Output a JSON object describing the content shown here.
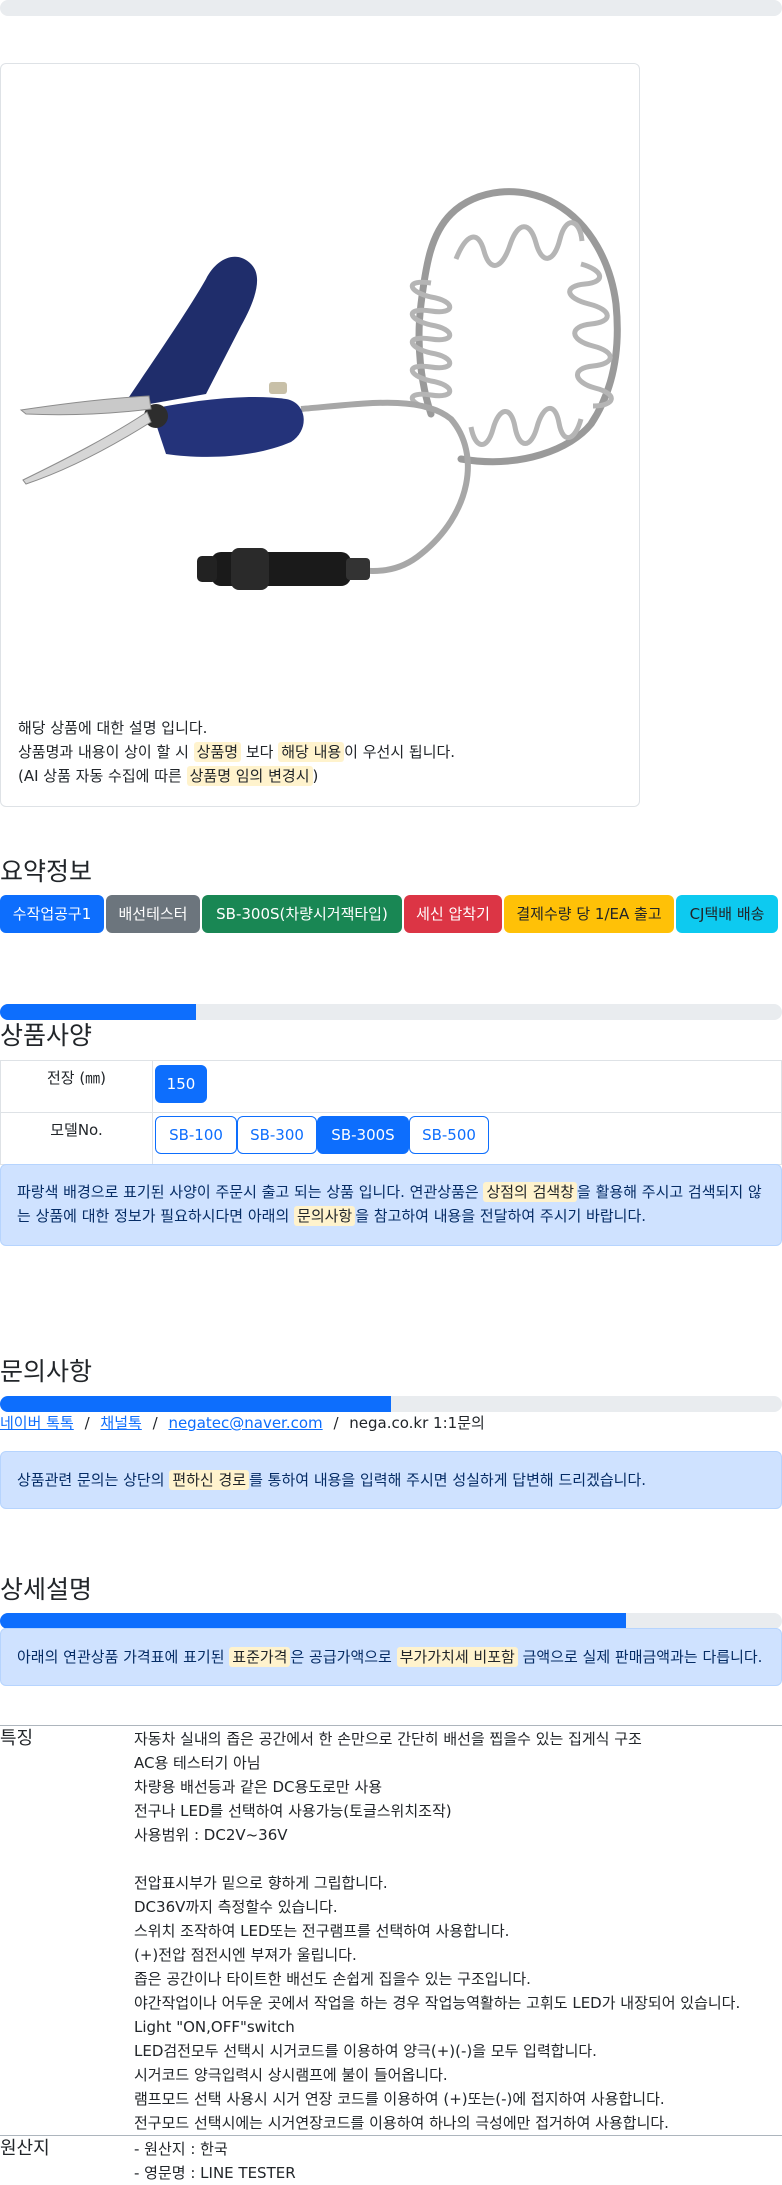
{
  "product_card": {
    "image_alt": "SB-300S 배선테스터",
    "desc_line1": "해당 상품에 대한 설명 입니다.",
    "desc_line2_pre": "상품명과 내용이 상이 할 시 ",
    "desc_line2_mark1": "상품명",
    "desc_line2_mid": " 보다 ",
    "desc_line2_mark2": "해당 내용",
    "desc_line2_post": "이 우선시 됩니다.",
    "desc_line3_pre": "(AI 상품 자동 수집에 따른 ",
    "desc_line3_mark": "상품명 임의 변경시",
    "desc_line3_post": ")"
  },
  "summary": {
    "title": "요약정보",
    "badges": [
      {
        "label": "수작업공구1",
        "color": "#0d6efd"
      },
      {
        "label": "배선테스터",
        "color": "#6c757d"
      },
      {
        "label": "SB-300S(차량시거잭타입)",
        "color": "#198754"
      },
      {
        "label": "세신 압착기",
        "color": "#dc3545"
      },
      {
        "label": "결제수량 당 1/EA 출고",
        "color": "#ffc107"
      },
      {
        "label": "CJ택배 배송",
        "color": "#0dcaf0"
      }
    ]
  },
  "spec": {
    "title": "상품사양",
    "progress": 0.25,
    "rows": [
      {
        "label": "전장 (㎜)",
        "options": [
          "150"
        ],
        "selected": "150"
      },
      {
        "label": "모델No.",
        "options": [
          "SB-100",
          "SB-300",
          "SB-300S",
          "SB-500"
        ],
        "selected": "SB-300S"
      }
    ],
    "notice_pre": "파랑색 배경으로 표기된 사양이 주문시 출고 되는 상품 입니다. 연관상품은 ",
    "notice_mark1": "상점의 검색창",
    "notice_mid": "을 활용해 주시고 검색되지 않는 상품에 대한 정보가 필요하시다면 아래의 ",
    "notice_mark2": "문의사항",
    "notice_post": "을 참고하여 내용을 전달하여 주시기 바랍니다."
  },
  "inquiry": {
    "title": "문의사항",
    "progress": 0.5,
    "links": [
      "네이버 톡톡",
      "채널톡",
      "negatec@naver.com"
    ],
    "separator": "/",
    "plain": "nega.co.kr 1:1문의",
    "notice_pre": "상품관련 문의는 상단의 ",
    "notice_mark": "편하신 경로",
    "notice_post": "를 통하여 내용을 입력해 주시면 성실하게 답변해 드리겠습니다."
  },
  "detail": {
    "title": "상세설명",
    "progress": 0.8,
    "notice_pre": "아래의 연관상품 가격표에 표기된 ",
    "notice_mark1": "표준가격",
    "notice_mid": "은 공급가액으로 ",
    "notice_mark2": "부가가치세 비포함",
    "notice_post": " 금액으로 실제 판매금액과는 다릅니다.",
    "features_label": "특징",
    "features": [
      "자동차 실내의 좁은 공간에서 한 손만으로 간단히 배선을 찝을수 있는 집게식 구조",
      "AC용 테스터기 아님",
      "차량용 배선등과 같은 DC용도로만 사용",
      "전구나 LED를 선택하여 사용가능(토글스위치조작)",
      "사용범위 : DC2V~36V",
      "",
      "전압표시부가 밑으로 향하게 그립합니다.",
      "DC36V까지 측정할수 있습니다.",
      "스위치 조작하여 LED또는 전구램프를 선택하여 사용합니다.",
      "(+)전압 점전시엔 부져가 울립니다.",
      "좁은 공간이나 타이트한 배선도 손쉽게 집을수 있는 구조입니다.",
      "야간작업이나 어두운 곳에서 작업을 하는 경우 작업능역활하는 고휘도 LED가 내장되어 있습니다.",
      "Light \"ON,OFF\"switch",
      "LED검전모두 선택시 시거코드를 이용하여 양극(+)(-)을 모두 입력합니다.",
      "시거코드 양극입력시 상시램프에 불이 들어옵니다.",
      "램프모드 선택 사용시 시거 연장 코드를 이용하여 (+)또는(-)에 접지하여 사용합니다.",
      "전구모드 선택시에는 시거연장코드를 이용하여 하나의 극성에만 접거하여 사용합니다."
    ],
    "origin_label": "원산지",
    "origin": [
      "- 원산지 : 한국",
      "- 영문명 : LINE TESTER"
    ]
  }
}
